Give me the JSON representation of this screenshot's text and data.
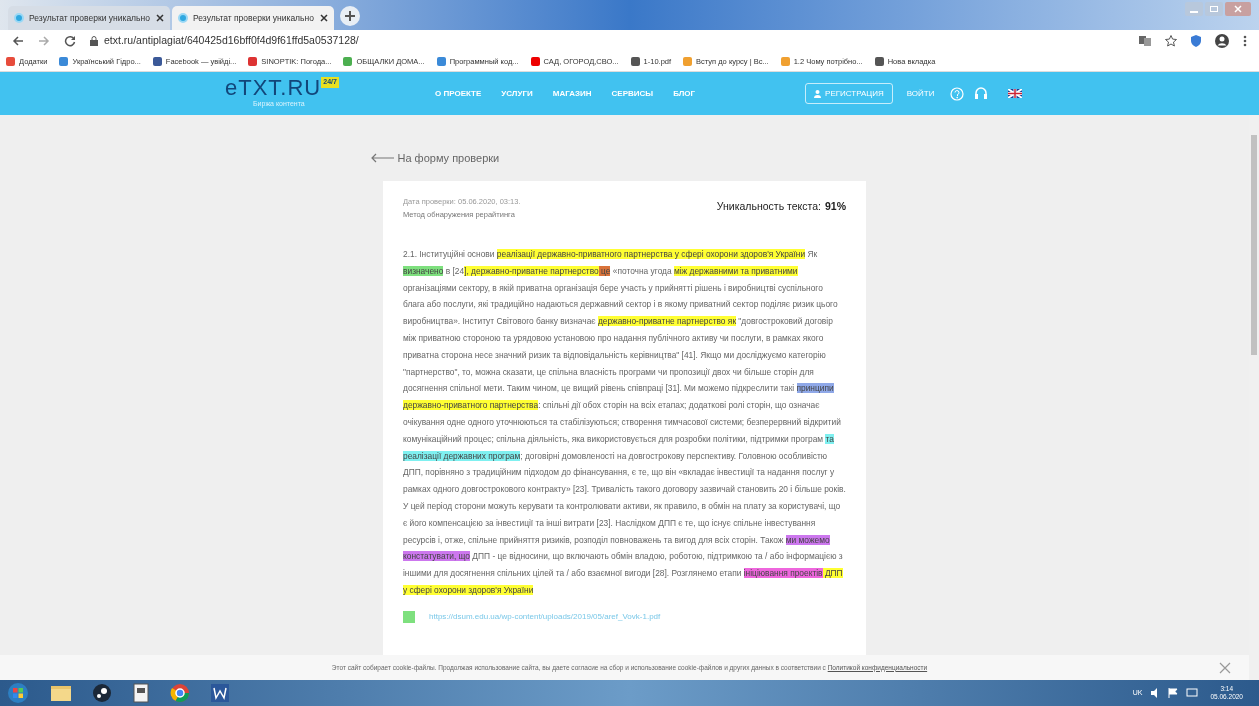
{
  "tabs": [
    {
      "title": "Результат проверки уникально",
      "selected": false
    },
    {
      "title": "Результат проверки уникально",
      "selected": true
    }
  ],
  "address": "etxt.ru/antiplagiat/640425d16bff0f4d9f61ffd5a0537128/",
  "bookmarks": [
    "Додатки",
    "Український Гідро...",
    "Facebook — увійді...",
    "SINOPTIK: Погода...",
    "ОБЩАЛКИ ДОМА...",
    "Программный код...",
    "САД, ОГОРОД,СВО...",
    "1-10.pdf",
    "Вступ до курсу | Вс...",
    "1.2 Чому потрібно...",
    "Нова вкладка"
  ],
  "site": {
    "logo": "eTXT.RU",
    "badge": "24/7",
    "tagline": "Биржа контента",
    "nav": [
      "О ПРОЕКТЕ",
      "УСЛУГИ",
      "МАГАЗИН",
      "СЕРВИСЫ",
      "БЛОГ"
    ],
    "register": "РЕГИСТРАЦИЯ",
    "login": "ВОЙТИ"
  },
  "back_link": "На форму проверки",
  "report": {
    "date": "Дата проверки: 05.06.2020, 03:13.",
    "method": "Метод обнаружения рерайтинга",
    "uniqueness_label": "Уникальность текста:",
    "uniqueness_value": "91%",
    "segments": [
      {
        "text": "2.1. Інституційні основи "
      },
      {
        "text": "реалізації державно-приватного партнерства у сфері охорони здоров'я України",
        "color": "#ffff33"
      },
      {
        "text": " Як "
      },
      {
        "text": "визначено",
        "color": "#7ee07e"
      },
      {
        "text": " в [24"
      },
      {
        "text": "], державно-приватне партнерство",
        "color": "#ffff33"
      },
      {
        "text": " це",
        "color": "#d9733a"
      },
      {
        "text": " «поточна угода "
      },
      {
        "text": "між державними та приватними",
        "color": "#ffff33"
      },
      {
        "text": " організаціями сектору, в якій приватна організація бере участь у прийнятті рішень і виробництві суспільного блага або послуги, які традиційно надаються державний сектор і в якому приватний сектор поділяє ризик цього виробництва». Інститут Світового банку визначає "
      },
      {
        "text": "державно-приватне партнерство як",
        "color": "#ffff33"
      },
      {
        "text": " \"довгостроковий договір між приватною стороною та урядовою установою про надання публічного активу чи послуги, в рамках якого приватна сторона несе значний ризик та відповідальність керівництва\" [41]. Якщо ми досліджуємо категорію \"партнерство\", то, можна сказати, це спільна власність програми чи пропозиції двох чи більше сторін для досягнення спільної мети. Таким чином, це вищий рівень співпраці [31]. Ми можемо підкреслити такі "
      },
      {
        "text": "принципи",
        "color": "#8fa8e8"
      },
      {
        "text": " державно-приватного партнерства",
        "color": "#ffff33"
      },
      {
        "text": ": спільні дії обох сторін на всіх етапах; додаткові ролі сторін, що означає очікування одне одного уточнюються та стабілізуються; створення тимчасової системи; безперервний відкритий комунікаційний процес; спільна діяльність, яка використовується для розробки політики, підтримки програм "
      },
      {
        "text": "та реалізації державних програм",
        "color": "#7ff0f0"
      },
      {
        "text": "; договірні домовленості на довгострокову перспективу. Головною особливістю ДПП, порівняно з традиційним підходом до фінансування, є те, що він «вкладає інвестиції та надання послуг у рамках одного довгострокового контракту» [23]. Тривалість такого договору зазвичай становить 20 і більше років. У цей період сторони можуть керувати та контролювати активи, як правило, в обмін на плату за користувачі, що є його компенсацією за інвестиції та інші витрати [23]. Наслідком ДПП є те, що існує спільне інвестування ресурсів і, отже, спільне прийняття ризиків, розподіл повноважень та вигод для всіх сторін. Також "
      },
      {
        "text": "ми можемо констатувати, що",
        "color": "#cc77ee"
      },
      {
        "text": " ДПП - це відносини, що включають обмін владою, роботою, підтримкою та / або інформацією з іншими для досягнення спільних цілей та / або взаємної вигоди [28]. Розглянемо етапи "
      },
      {
        "text": "ініціювання проектів",
        "color": "#ee66dd"
      },
      {
        "text": " ДПП у сфері охорони здоров'я України",
        "color": "#ffff33"
      }
    ],
    "sources": [
      {
        "url": "https://dsum.edu.ua/wp-content/uploads/2019/05/aref_Vovk-1.pdf",
        "color": "#7ee07e"
      }
    ]
  },
  "cookie": {
    "text": "Этот сайт собирает cookie-файлы. Продолжая использование сайта, вы даете согласие на сбор и использование cookie-файлов и других данных в соответствии с ",
    "link": "Политикой конфиденциальности"
  },
  "taskbar": {
    "lang": "UK",
    "time": "3:14",
    "date": "05.06.2020"
  }
}
